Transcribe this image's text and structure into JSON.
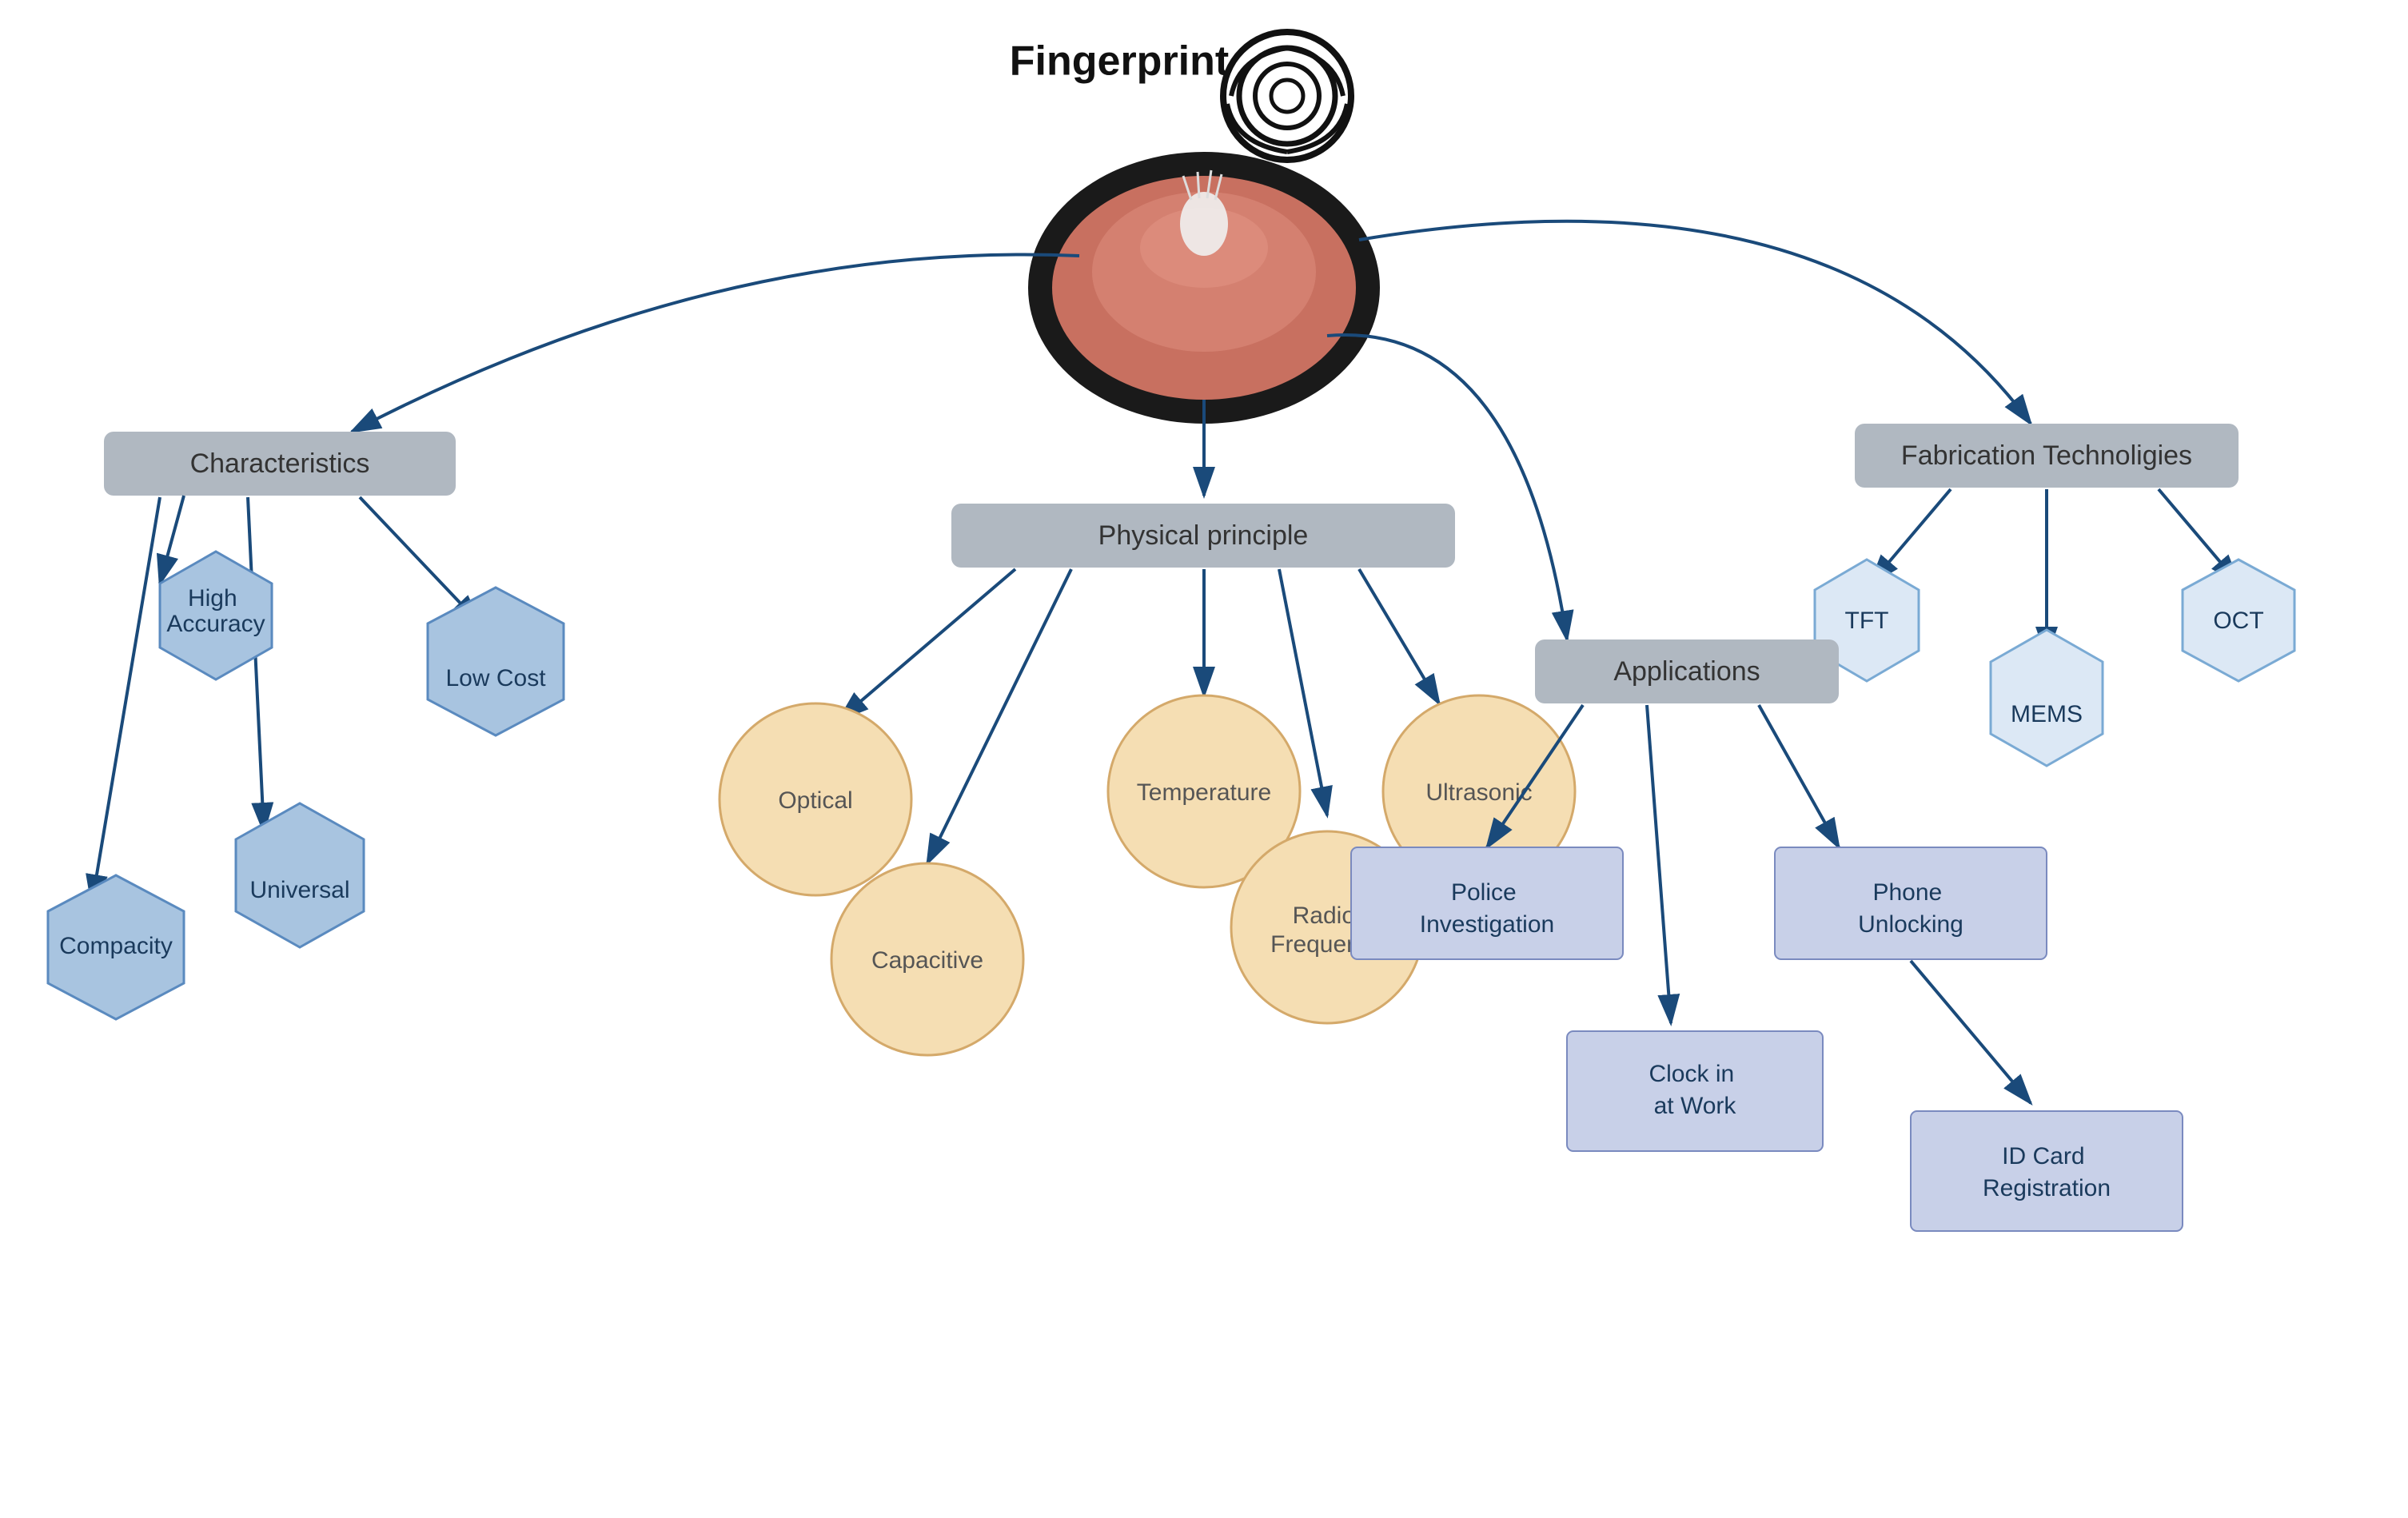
{
  "title": "Fingerprint",
  "nodes": {
    "characteristics": "Characteristics",
    "high_accuracy": "High Accuracy",
    "universal": "Universal",
    "compacity": "Compacity",
    "low_cost": "Low Cost",
    "physical_principle": "Physical principle",
    "optical": "Optical",
    "capacitive": "Capacitive",
    "temperature": "Temperature",
    "radio_frequency": "Radio Frequency",
    "ultrasonic": "Ultrasonic",
    "fabrication": "Fabrication Technoligies",
    "tft": "TFT",
    "mems": "MEMS",
    "oct": "OCT",
    "applications": "Applications",
    "police_investigation": "Police Investigation",
    "clock_in": "Clock in at Work",
    "phone_unlocking": "Phone Unlocking",
    "id_card": "ID Card Registration"
  },
  "colors": {
    "arrow": "#1a4a7a",
    "box_bg": "#b0b8c1",
    "hex_fill": "#a8c4e0",
    "hex_stroke": "#5a8abf",
    "circle_fill": "#f5deb3",
    "circle_stroke": "#d4a96a",
    "app_fill": "#c8d0e8",
    "app_stroke": "#7a8abf",
    "fab_hex_fill": "#dce8f5",
    "fab_hex_stroke": "#7aaad4"
  }
}
